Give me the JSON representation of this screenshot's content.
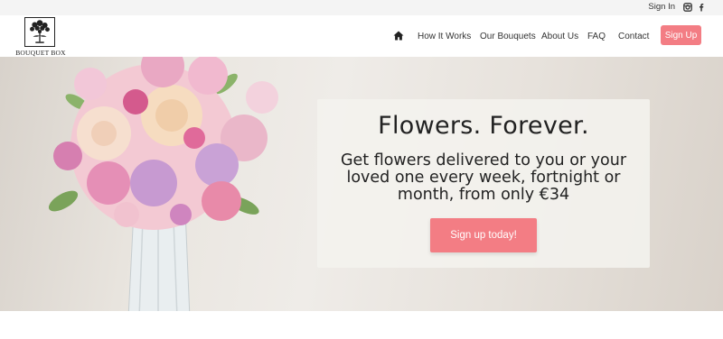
{
  "topbar": {
    "sign_in": "Sign In",
    "social": [
      "instagram-icon",
      "facebook-icon"
    ]
  },
  "logo": {
    "brand": "BOUQUET BOX"
  },
  "nav": {
    "home_icon": "home-icon",
    "items": [
      "How It Works",
      "Our Bouquets",
      "About Us",
      "FAQ",
      "Contact"
    ],
    "signup": "Sign Up"
  },
  "hero": {
    "title": "Flowers. Forever.",
    "subtitle": "Get flowers delivered to you or your loved one every week, fortnight or month, from only €34",
    "cta": "Sign up today!"
  },
  "colors": {
    "accent": "#f37d84",
    "topbar_bg": "#f4f4f4"
  }
}
